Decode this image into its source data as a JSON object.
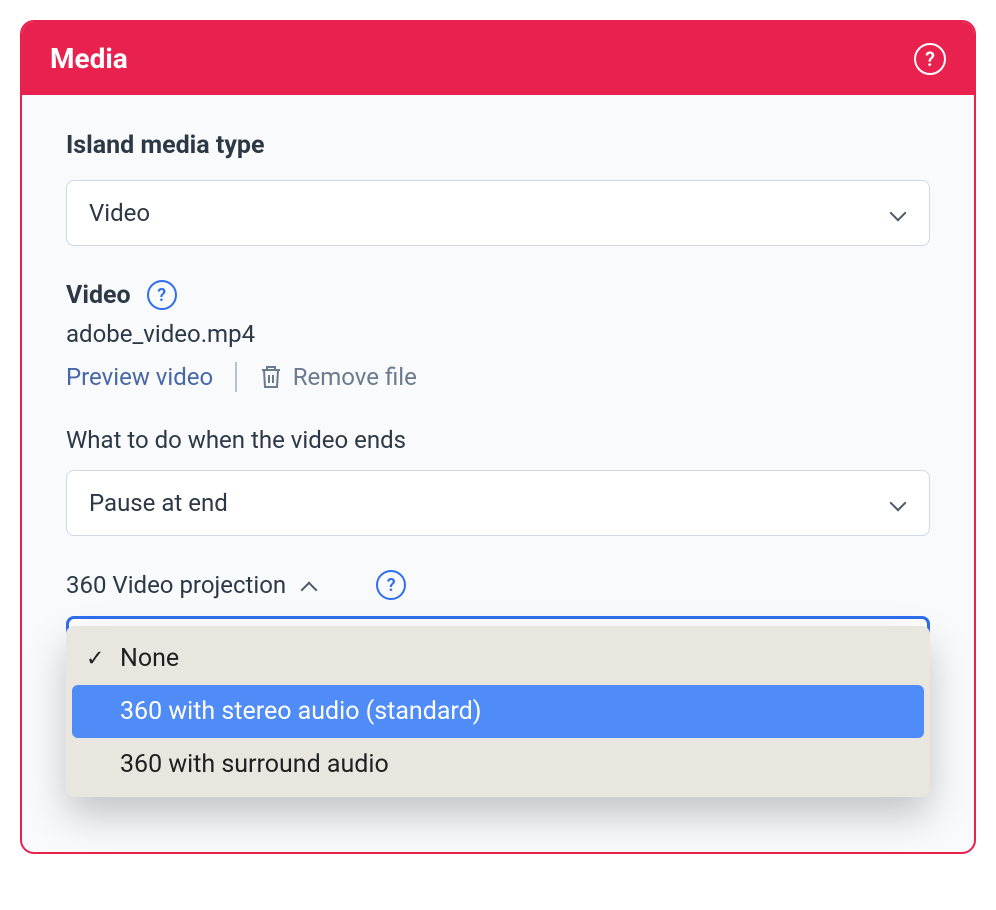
{
  "header": {
    "title": "Media",
    "help_glyph": "?"
  },
  "media_type": {
    "label": "Island media type",
    "selected": "Video"
  },
  "video": {
    "heading": "Video",
    "filename": "adobe_video.mp4",
    "preview_label": "Preview video",
    "remove_label": "Remove file"
  },
  "on_end": {
    "label": "What to do when the video ends",
    "selected": "Pause at end"
  },
  "projection": {
    "label": "360 Video projection",
    "options": {
      "none": "None",
      "stereo": "360 with stereo audio (standard)",
      "surround": "360 with surround audio"
    },
    "selected_key": "none",
    "highlighted_key": "stereo"
  }
}
